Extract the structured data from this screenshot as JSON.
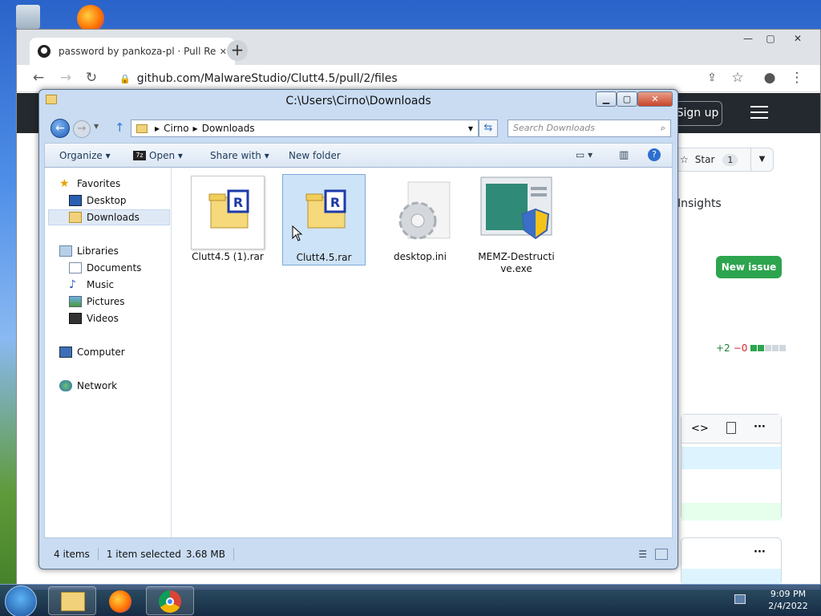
{
  "chrome": {
    "tab_title": "password by pankoza-pl · Pull Re",
    "tab_close": "✕",
    "new_tab": "+",
    "url": "github.com/MalwareStudio/Clutt4.5/pull/2/files",
    "minimize": "—",
    "maximize": "▢",
    "close": "✕"
  },
  "github": {
    "signup": "Sign up",
    "star_label": "Star",
    "star_count": "1",
    "insights": "Insights",
    "new_issue": "New issue",
    "diff_add": "+2",
    "diff_del": "−0",
    "ellipsis": "···"
  },
  "explorer": {
    "title": "C:\\Users\\Cirno\\Downloads",
    "breadcrumb": [
      "Cirno",
      "Downloads"
    ],
    "search_placeholder": "Search Downloads",
    "commands": {
      "organize": "Organize ▾",
      "open": "Open ▾",
      "share": "Share with ▾",
      "new_folder": "New folder"
    },
    "nav": {
      "favorites": "Favorites",
      "desktop": "Desktop",
      "downloads": "Downloads",
      "libraries": "Libraries",
      "documents": "Documents",
      "music": "Music",
      "pictures": "Pictures",
      "videos": "Videos",
      "computer": "Computer",
      "network": "Network"
    },
    "files": [
      {
        "name": "Clutt4.5 (1).rar"
      },
      {
        "name": "Clutt4.5.rar"
      },
      {
        "name": "desktop.ini"
      },
      {
        "name": "MEMZ-Destructive.exe"
      }
    ],
    "status": {
      "items": "4 items",
      "selected": "1 item selected",
      "size": "3.68 MB"
    }
  },
  "taskbar": {
    "time": "9:09 PM",
    "date": "2/4/2022"
  },
  "colors": {
    "github_header": "#24292f",
    "new_issue_green": "#2da44e",
    "selection_blue": "#cde3f7"
  }
}
